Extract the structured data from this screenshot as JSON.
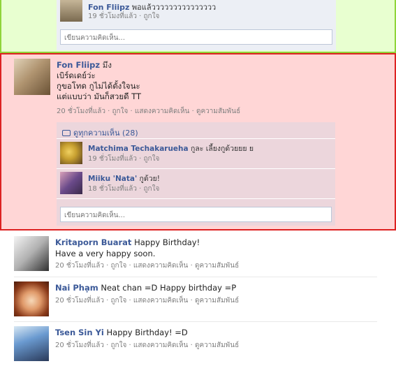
{
  "top_comment": {
    "author": "Fon Fliipz",
    "text": "พอแล้ววววววววววววววว",
    "time": "19 ชั่วโมงที่แล้ว",
    "like": "ถูกใจ"
  },
  "comment_placeholder": "เขียนความคิดเห็น...",
  "main_post": {
    "author": "Fon Fliipz",
    "first_line": "มึง",
    "body_lines": [
      "เบิร์ดเดย์ว่ะ",
      "กูขอโทด กูไม่ได้ตั้งใจนะ",
      "แต่แบบว่า มันก็สวยดี TT"
    ],
    "time": "20 ชั่วโมงที่แล้ว",
    "like": "ถูกใจ",
    "comment": "แสดงความคิดเห็น",
    "relation": "ดูความสัมพันธ์",
    "view_all": "ดูทุกความเห็น (28)",
    "comments": [
      {
        "author": "Matchima Techakarueha",
        "text": "กูละ เลี้ยงกูด้วยยย ย",
        "time": "19 ชั่วโมงที่แล้ว",
        "like": "ถูกใจ"
      },
      {
        "author": "Miiku 'Nata'",
        "text": "กูด้วย!",
        "time": "18 ชั่วโมงที่แล้ว",
        "like": "ถูกใจ"
      }
    ]
  },
  "posts": [
    {
      "author": "Kritaporn Buarat",
      "text": "Happy Birthday!",
      "text2": "Have a very happy soon.",
      "time": "20 ชั่วโมงที่แล้ว",
      "like": "ถูกใจ",
      "comment": "แสดงความคิดเห็น",
      "relation": "ดูความสัมพันธ์"
    },
    {
      "author": "Nai Phạm",
      "text": "Neat chan =D Happy birthday =P",
      "time": "20 ชั่วโมงที่แล้ว",
      "like": "ถูกใจ",
      "comment": "แสดงความคิดเห็น",
      "relation": "ดูความสัมพันธ์"
    },
    {
      "author": "Tsen Sin Yi",
      "text": "Happy Birthday! =D",
      "time": "20 ชั่วโมงที่แล้ว",
      "like": "ถูกใจ",
      "comment": "แสดงความคิดเห็น",
      "relation": "ดูความสัมพันธ์"
    }
  ],
  "sep": "·"
}
